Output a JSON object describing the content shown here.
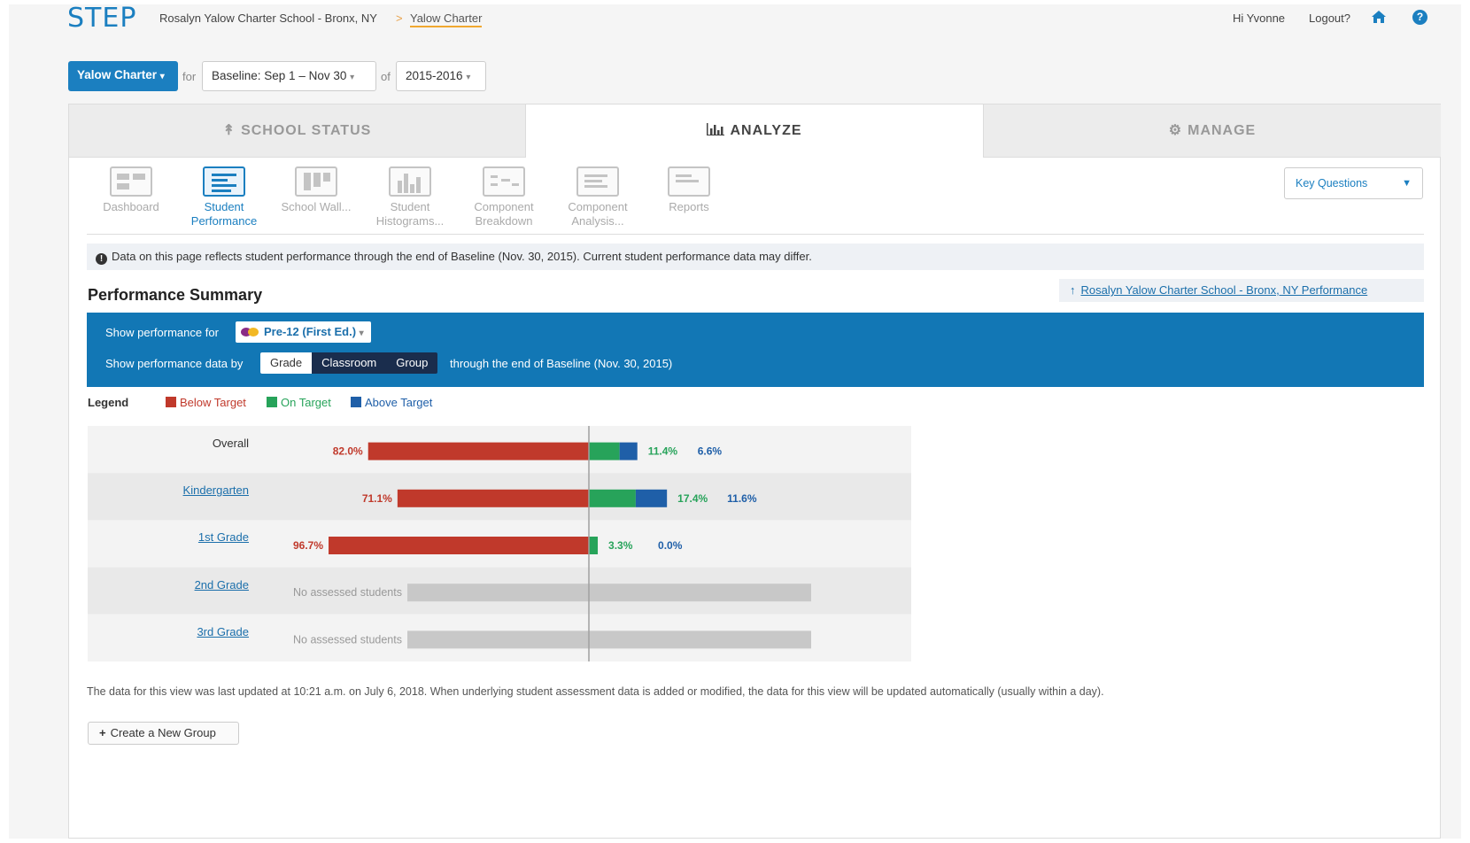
{
  "header": {
    "logo": "STEP",
    "breadcrumb_school": "Rosalyn Yalow Charter School - Bronx, NY",
    "breadcrumb_sep": ">",
    "breadcrumb_current": "Yalow Charter",
    "greeting": "Hi Yvonne",
    "logout": "Logout?",
    "home_icon": "home-icon",
    "help_icon": "question-circle-icon",
    "help_glyph": "?"
  },
  "filters": {
    "school": "Yalow Charter",
    "for_word": "for",
    "period": "Baseline: Sep 1 – Nov 30",
    "of_word": "of",
    "year": "2015-2016"
  },
  "tabs": {
    "school_status": "SCHOOL STATUS",
    "analyze": "ANALYZE",
    "manage": "MANAGE"
  },
  "subnav": [
    {
      "line1": "Dashboard",
      "line2": "",
      "active": false
    },
    {
      "line1": "Student",
      "line2": "Performance",
      "active": true
    },
    {
      "line1": "School Wall...",
      "line2": "",
      "active": false
    },
    {
      "line1": "Student",
      "line2": "Histograms...",
      "active": false
    },
    {
      "line1": "Component",
      "line2": "Breakdown",
      "active": false
    },
    {
      "line1": "Component",
      "line2": "Analysis...",
      "active": false
    },
    {
      "line1": "Reports",
      "line2": "",
      "active": false
    }
  ],
  "key_questions": "Key Questions",
  "notice": "Data on this page reflects student performance through the end of Baseline (Nov. 30, 2015). Current student performance data may differ.",
  "performance": {
    "title": "Performance Summary",
    "school_link": "Rosalyn Yalow Charter School - Bronx, NY Performance",
    "show_for_label": "Show performance for",
    "show_for_value": "Pre-12 (First Ed.)",
    "show_by_label": "Show performance data by",
    "show_by_options": [
      "Grade",
      "Classroom",
      "Group"
    ],
    "show_by_selected": "Grade",
    "through_text": "through the end of Baseline (Nov. 30, 2015)"
  },
  "legend": {
    "title": "Legend",
    "items": [
      {
        "label": "Below Target",
        "color": "#c0392b"
      },
      {
        "label": "On Target",
        "color": "#27a35a"
      },
      {
        "label": "Above Target",
        "color": "#1f5fa8"
      }
    ]
  },
  "chart_data": {
    "type": "bar",
    "categories": [
      "Overall",
      "Kindergarten",
      "1st Grade",
      "2nd Grade",
      "3rd Grade"
    ],
    "series": [
      {
        "name": "Below Target",
        "values": [
          82.0,
          71.1,
          96.7,
          null,
          null
        ],
        "labels": [
          "82.0%",
          "71.1%",
          "96.7%",
          "",
          ""
        ]
      },
      {
        "name": "On Target",
        "values": [
          11.4,
          17.4,
          3.3,
          null,
          null
        ],
        "labels": [
          "11.4%",
          "17.4%",
          "3.3%",
          "",
          ""
        ]
      },
      {
        "name": "Above Target",
        "values": [
          6.6,
          11.6,
          0.0,
          null,
          null
        ],
        "labels": [
          "6.6%",
          "11.6%",
          "0.0%",
          "",
          ""
        ]
      }
    ],
    "no_data_text": "No assessed students",
    "category_links": [
      false,
      true,
      true,
      true,
      true
    ]
  },
  "footer": {
    "updated_text": "The data for this view was last updated at 10:21 a.m. on July 6, 2018. When underlying student assessment data is added or modified, the data for this view will be updated automatically (usually within a day).",
    "new_group_button": "Create a New Group"
  }
}
